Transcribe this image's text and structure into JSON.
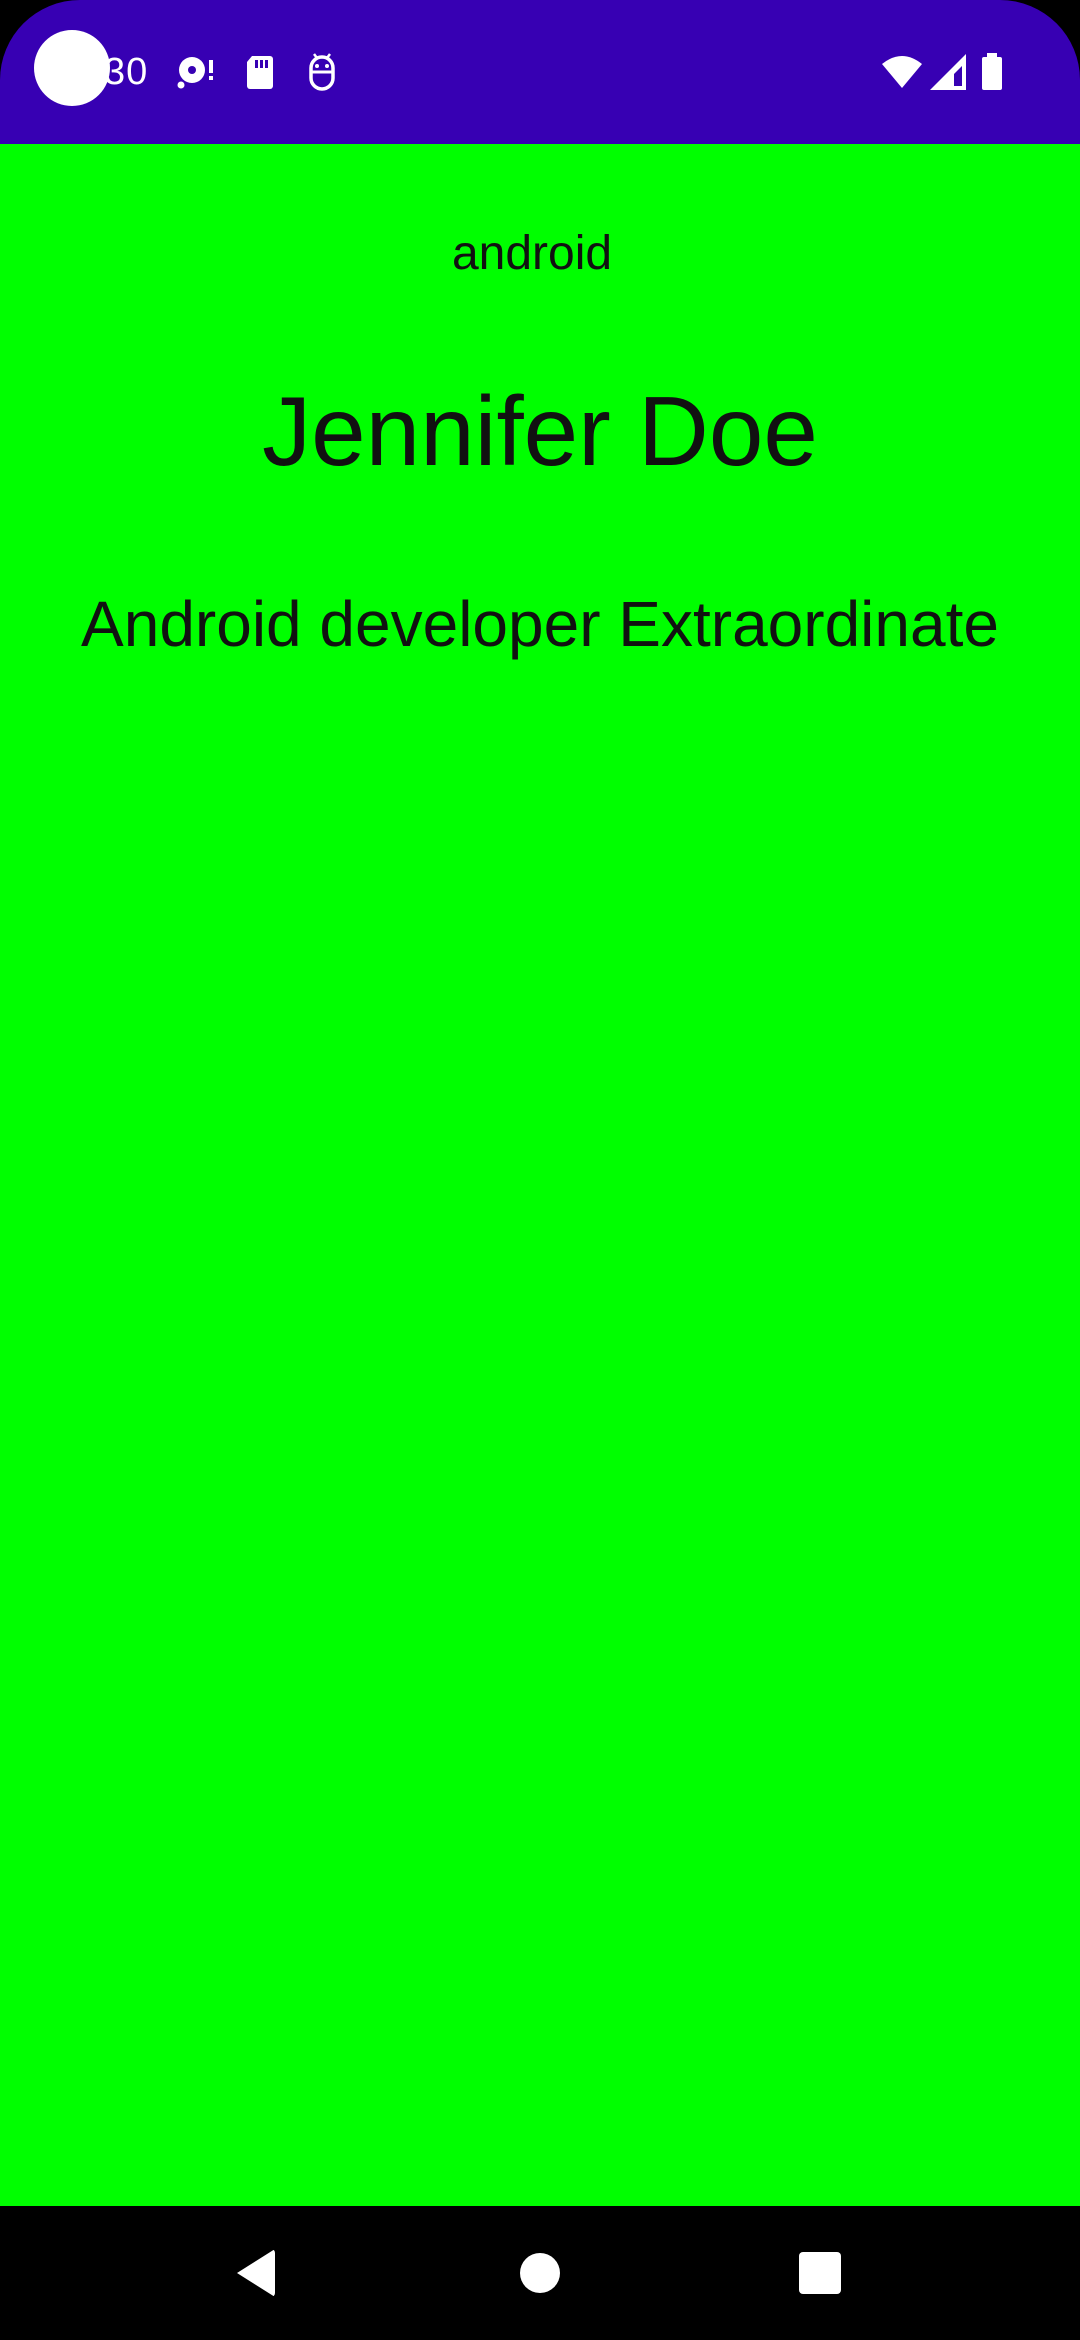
{
  "status_bar": {
    "time": "30",
    "background_color": "#3700b3",
    "left_icons": [
      "disc-alert-icon",
      "sd-card-icon",
      "android-debug-icon"
    ],
    "right_icons": [
      "wifi-icon",
      "cell-signal-icon",
      "battery-icon"
    ]
  },
  "main": {
    "background_color": "#00ff00",
    "small_label": "android",
    "name": "Jennifer Doe",
    "tagline": "Android developer Extraordinate"
  },
  "nav_bar": {
    "buttons": [
      "back-icon",
      "home-icon",
      "recents-icon"
    ]
  }
}
